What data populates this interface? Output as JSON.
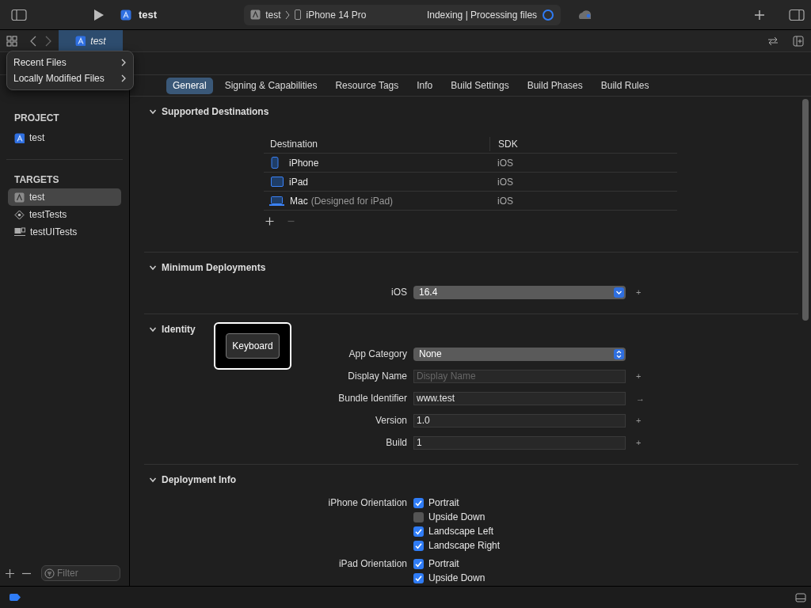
{
  "toolbar": {
    "scheme": "test",
    "breadcrumb": [
      "test",
      "iPhone 14 Pro"
    ],
    "status": "Indexing | Processing files"
  },
  "editor_tabs": [
    {
      "title": "test",
      "selected": true
    }
  ],
  "popup_menu": {
    "items": [
      {
        "label": "Recent Files"
      },
      {
        "label": "Locally Modified Files"
      }
    ]
  },
  "tabs": [
    {
      "label": "General",
      "selected": true
    },
    {
      "label": "Signing & Capabilities",
      "selected": false
    },
    {
      "label": "Resource Tags",
      "selected": false
    },
    {
      "label": "Info",
      "selected": false
    },
    {
      "label": "Build Settings",
      "selected": false
    },
    {
      "label": "Build Phases",
      "selected": false
    },
    {
      "label": "Build Rules",
      "selected": false
    }
  ],
  "sidebar": {
    "groups": [
      {
        "heading": "PROJECT",
        "items": [
          {
            "label": "test",
            "kind": "project",
            "selected": false
          }
        ]
      },
      {
        "heading": "TARGETS",
        "items": [
          {
            "label": "test",
            "kind": "app",
            "selected": true
          },
          {
            "label": "testTests",
            "kind": "unit-tests",
            "selected": false
          },
          {
            "label": "testUITests",
            "kind": "ui-tests",
            "selected": false
          }
        ]
      }
    ],
    "filter": {
      "placeholder": "Filter"
    }
  },
  "sections": [
    {
      "kind": "table",
      "title": "Supported Destinations",
      "expanded": true,
      "columns": [
        "Destination",
        "SDK"
      ],
      "rows": [
        {
          "kind": "iphone",
          "name": "iPhone",
          "sdk": "iOS"
        },
        {
          "kind": "ipad",
          "name": "iPad",
          "sdk": "iOS"
        },
        {
          "kind": "mac",
          "name": "Mac",
          "note": "(Designed for iPad)",
          "sdk": "iOS"
        }
      ]
    },
    {
      "kind": "fields",
      "title": "Minimum Deployments",
      "expanded": true,
      "fields": [
        {
          "label": "iOS",
          "kind": "pulldown",
          "value": "16.4",
          "action": "+"
        }
      ]
    },
    {
      "kind": "fields",
      "title": "Identity",
      "expanded": true,
      "fields": [
        {
          "label": "App Category",
          "kind": "popup",
          "value": "None"
        },
        {
          "label": "Display Name",
          "kind": "text",
          "placeholder": "Display Name",
          "action": "+"
        },
        {
          "label": "Bundle Identifier",
          "kind": "text",
          "value": "www.test",
          "action": "→"
        },
        {
          "label": "Version",
          "kind": "text",
          "value": "1.0",
          "action": "+"
        },
        {
          "label": "Build",
          "kind": "text",
          "value": "1",
          "action": "+"
        }
      ]
    },
    {
      "kind": "checks",
      "title": "Deployment Info",
      "expanded": true,
      "groups": [
        {
          "label": "iPhone Orientation",
          "options": [
            {
              "label": "Portrait",
              "checked": true
            },
            {
              "label": "Upside Down",
              "checked": false
            },
            {
              "label": "Landscape Left",
              "checked": true
            },
            {
              "label": "Landscape Right",
              "checked": true
            }
          ]
        },
        {
          "label": "iPad Orientation",
          "options": [
            {
              "label": "Portrait",
              "checked": true
            },
            {
              "label": "Upside Down",
              "checked": true
            }
          ]
        }
      ]
    }
  ],
  "keystroke_overlay": {
    "key": "Keyboard"
  }
}
